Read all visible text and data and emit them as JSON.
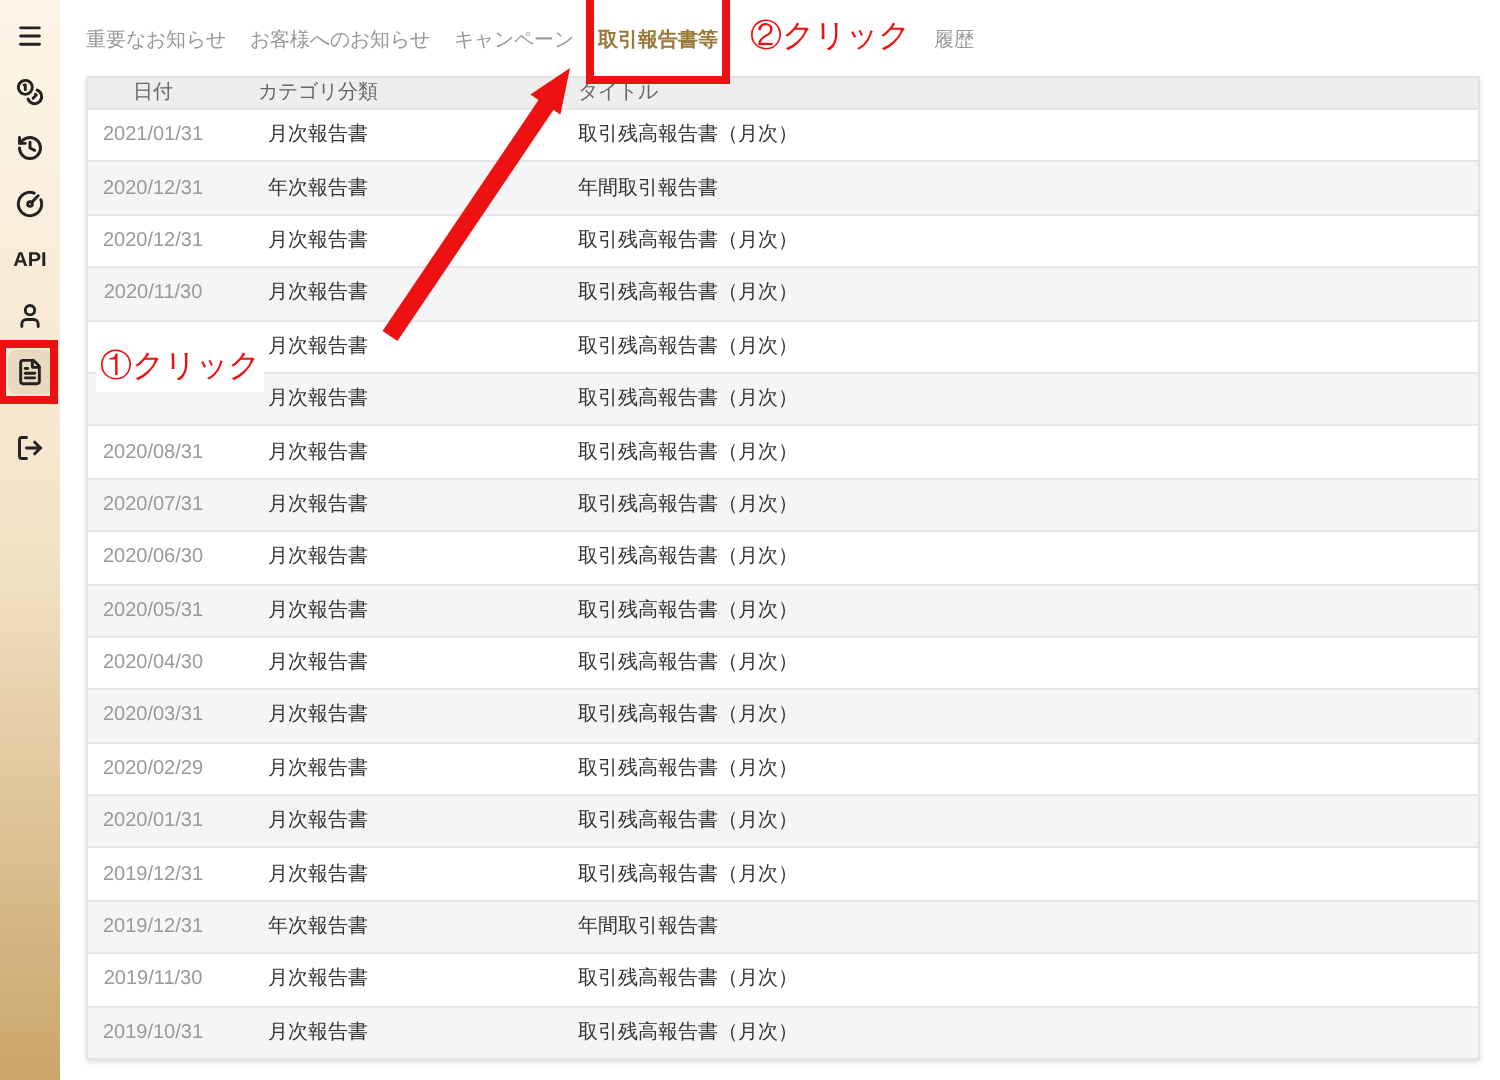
{
  "sidebar": {
    "items": [
      {
        "kind": "icon",
        "selected": false
      },
      {
        "kind": "icon",
        "selected": false
      },
      {
        "kind": "icon",
        "selected": false
      },
      {
        "kind": "icon",
        "selected": false
      },
      {
        "kind": "text",
        "label": "API",
        "selected": false
      },
      {
        "kind": "icon",
        "selected": false
      },
      {
        "kind": "icon",
        "selected": true
      },
      {
        "kind": "icon",
        "selected": false
      }
    ]
  },
  "tabs": [
    {
      "label": "重要なお知らせ",
      "selected": false
    },
    {
      "label": "お客様へのお知らせ",
      "selected": false
    },
    {
      "label": "キャンペーン",
      "selected": false
    },
    {
      "label": "取引報告書等",
      "selected": true
    },
    {
      "label": "履歴",
      "selected": false
    }
  ],
  "table": {
    "columns": [
      "日付",
      "カテゴリ分類",
      "タイトル"
    ],
    "rows": [
      {
        "date": "2021/01/31",
        "category": "月次報告書",
        "title": "取引残高報告書（月次）"
      },
      {
        "date": "2020/12/31",
        "category": "年次報告書",
        "title": "年間取引報告書"
      },
      {
        "date": "2020/12/31",
        "category": "月次報告書",
        "title": "取引残高報告書（月次）"
      },
      {
        "date": "2020/11/30",
        "category": "月次報告書",
        "title": "取引残高報告書（月次）"
      },
      {
        "category": "月次報告書",
        "title": "取引残高報告書（月次）"
      },
      {
        "category": "月次報告書",
        "title": "取引残高報告書（月次）"
      },
      {
        "date": "2020/08/31",
        "category": "月次報告書",
        "title": "取引残高報告書（月次）"
      },
      {
        "date": "2020/07/31",
        "category": "月次報告書",
        "title": "取引残高報告書（月次）"
      },
      {
        "date": "2020/06/30",
        "category": "月次報告書",
        "title": "取引残高報告書（月次）"
      },
      {
        "date": "2020/05/31",
        "category": "月次報告書",
        "title": "取引残高報告書（月次）"
      },
      {
        "date": "2020/04/30",
        "category": "月次報告書",
        "title": "取引残高報告書（月次）"
      },
      {
        "date": "2020/03/31",
        "category": "月次報告書",
        "title": "取引残高報告書（月次）"
      },
      {
        "date": "2020/02/29",
        "category": "月次報告書",
        "title": "取引残高報告書（月次）"
      },
      {
        "date": "2020/01/31",
        "category": "月次報告書",
        "title": "取引残高報告書（月次）"
      },
      {
        "date": "2019/12/31",
        "category": "月次報告書",
        "title": "取引残高報告書（月次）"
      },
      {
        "date": "2019/12/31",
        "category": "年次報告書",
        "title": "年間取引報告書"
      },
      {
        "date": "2019/11/30",
        "category": "月次報告書",
        "title": "取引残高報告書（月次）"
      },
      {
        "date": "2019/10/31",
        "category": "月次報告書",
        "title": "取引残高報告書（月次）"
      }
    ]
  },
  "annotations": [
    {
      "text": "①クリック"
    },
    {
      "text": "②クリック"
    }
  ]
}
